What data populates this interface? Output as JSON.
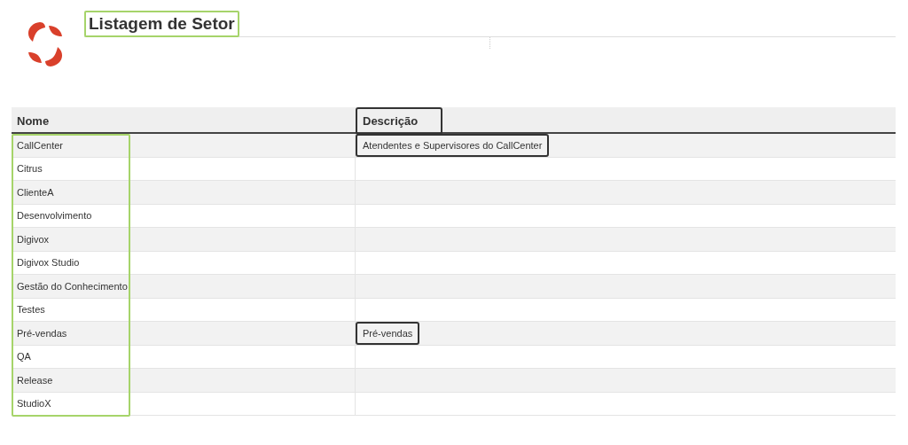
{
  "page": {
    "title": "Listagem de Setor"
  },
  "table": {
    "columns": [
      "Nome",
      "Descrição"
    ],
    "rows": [
      {
        "name": "CallCenter",
        "description": "Atendentes e Supervisores do CallCenter"
      },
      {
        "name": "Citrus"
      },
      {
        "name": "ClienteA"
      },
      {
        "name": "Desenvolvimento"
      },
      {
        "name": "Digivox"
      },
      {
        "name": "Digivox Studio"
      },
      {
        "name": "Gestão do Conhecimento"
      },
      {
        "name": "Testes"
      },
      {
        "name": "Pré-vendas",
        "description": "Pré-vendas"
      },
      {
        "name": "QA"
      },
      {
        "name": "Release"
      },
      {
        "name": "StudioX"
      }
    ]
  }
}
